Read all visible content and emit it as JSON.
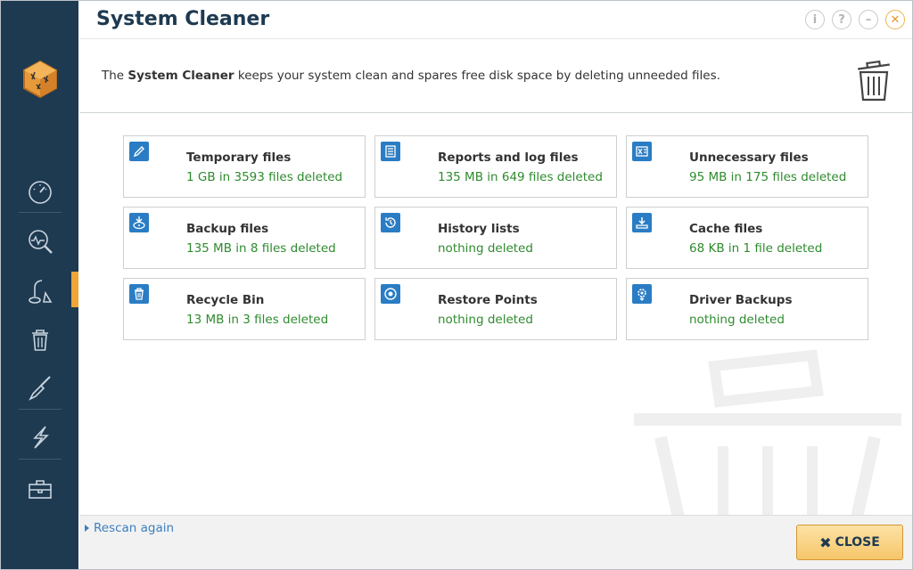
{
  "header": {
    "title": "System Cleaner",
    "description_prefix": "The ",
    "description_bold": "System Cleaner",
    "description_suffix": " keeps your system clean and spares free disk space by deleting unneeded files."
  },
  "title_controls": [
    "info-icon",
    "help-icon",
    "minimize-icon",
    "close-icon"
  ],
  "sidebar": {
    "items": [
      {
        "icon": "dashboard-icon"
      },
      {
        "icon": "analyze-icon"
      },
      {
        "icon": "vacuum-cleaner-icon",
        "active": true
      },
      {
        "icon": "trash-icon"
      },
      {
        "icon": "screwdriver-icon"
      },
      {
        "icon": "lightning-icon"
      },
      {
        "icon": "toolbox-icon"
      }
    ]
  },
  "tiles": [
    {
      "title": "Temporary files",
      "status": "1 GB in 3593 files deleted",
      "icon": "pencil-icon"
    },
    {
      "title": "Reports and log files",
      "status": "135 MB in 649 files deleted",
      "icon": "document-icon"
    },
    {
      "title": "Unnecessary files",
      "status": "95 MB in 175 files deleted",
      "icon": "excel-file-icon"
    },
    {
      "title": "Backup files",
      "status": "135 MB in 8 files deleted",
      "icon": "disk-download-icon"
    },
    {
      "title": "History lists",
      "status": "nothing deleted",
      "icon": "history-icon"
    },
    {
      "title": "Cache files",
      "status": "68 KB in 1 file deleted",
      "icon": "download-icon"
    },
    {
      "title": "Recycle Bin",
      "status": "13 MB in 3 files deleted",
      "icon": "recycle-bin-icon"
    },
    {
      "title": "Restore Points",
      "status": "nothing deleted",
      "icon": "restore-point-icon"
    },
    {
      "title": "Driver Backups",
      "status": "nothing deleted",
      "icon": "gear-download-icon"
    }
  ],
  "footer": {
    "rescan_label": "Rescan again",
    "close_label": "CLOSE"
  },
  "colors": {
    "sidebar_bg": "#1e3a51",
    "accent": "#f0a536",
    "status_green": "#2e8b2e",
    "tile_icon_blue": "#2a7dc4",
    "link_blue": "#3c7fc0"
  }
}
